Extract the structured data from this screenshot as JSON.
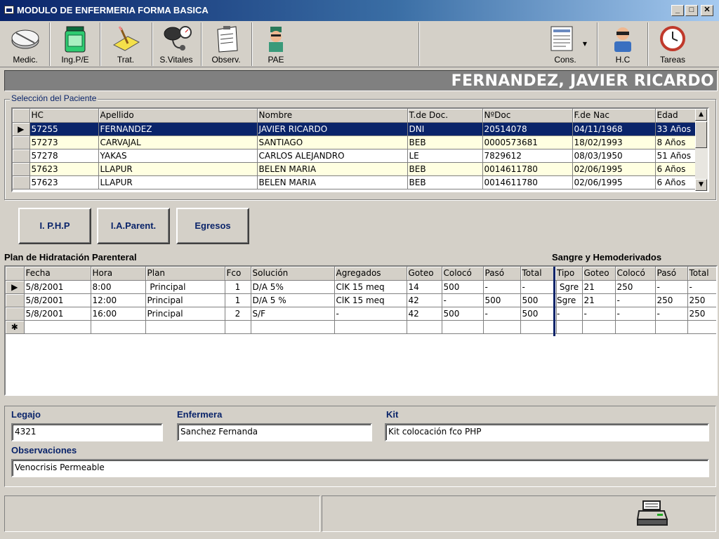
{
  "window": {
    "title": "MODULO DE ENFERMERIA FORMA BASICA"
  },
  "toolbar": {
    "left": [
      {
        "label": "Medic.",
        "icon": "pill-icon"
      },
      {
        "label": "Ing.P/E",
        "icon": "jar-icon"
      },
      {
        "label": "Trat.",
        "icon": "pencil-paper-icon"
      },
      {
        "label": "S.Vitales",
        "icon": "blood-pressure-icon"
      },
      {
        "label": "Observ.",
        "icon": "clipboard-icon"
      },
      {
        "label": "PAE",
        "icon": "nurse-icon"
      }
    ],
    "right": [
      {
        "label": "Cons.",
        "icon": "document-list-icon"
      },
      {
        "label": "H.C",
        "icon": "doctor-icon"
      },
      {
        "label": "Tareas",
        "icon": "clock-icon"
      }
    ]
  },
  "patient_name": "FERNANDEZ, JAVIER RICARDO",
  "patient_group_label": "Selección del Paciente",
  "patients": {
    "columns": [
      "HC",
      "Apellido",
      "Nombre",
      "T.de Doc.",
      "NºDoc",
      "F.de Nac",
      "Edad"
    ],
    "rows": [
      [
        "57255",
        "FERNANDEZ",
        "JAVIER RICARDO",
        "DNI",
        "20514078",
        "04/11/1968",
        "33 Años"
      ],
      [
        "57273",
        "CARVAJAL",
        "SANTIAGO",
        "BEB",
        "0000573681",
        "18/02/1993",
        "8 Años"
      ],
      [
        "57278",
        "YAKAS",
        "CARLOS ALEJANDRO",
        "LE",
        "7829612",
        "08/03/1950",
        "51 Años"
      ],
      [
        "57623",
        "LLAPUR",
        "BELEN MARIA",
        "BEB",
        "0014611780",
        "02/06/1995",
        "6 Años"
      ],
      [
        "57623",
        "LLAPUR",
        "BELEN MARIA",
        "BEB",
        "0014611780",
        "02/06/1995",
        "6 Años"
      ]
    ]
  },
  "buttons": {
    "iphp": "I. P.H.P",
    "iaparent": "I.A.Parent.",
    "egresos": "Egresos"
  },
  "plan": {
    "title": "Plan de Hidratación Parenteral",
    "columns": [
      "Fecha",
      "Hora",
      "Plan",
      "Fco",
      "Solución",
      "Agregados",
      "Goteo",
      "Colocó",
      "Pasó",
      "Total"
    ],
    "rows": [
      [
        "5/8/2001",
        "8:00",
        " Principal",
        "1",
        "D/A 5%",
        "ClK 15 meq",
        "14",
        "500",
        "-",
        "-"
      ],
      [
        "5/8/2001",
        "12:00",
        "Principal",
        "1",
        "D/A 5 %",
        "ClK 15 meq",
        "42",
        "-",
        "500",
        "500"
      ],
      [
        "5/8/2001",
        "16:00",
        "Principal",
        "2",
        "S/F",
        "-",
        "42",
        "500",
        "-",
        "500"
      ]
    ]
  },
  "sangre": {
    "title": "Sangre y Hemoderivados",
    "columns": [
      "Tipo",
      "Goteo",
      "Colocó",
      "Pasó",
      "Total"
    ],
    "rows": [
      [
        " Sgre",
        "21",
        "250",
        "-",
        "-"
      ],
      [
        "Sgre",
        "21",
        "-",
        "250",
        "250"
      ],
      [
        "-",
        "-",
        "-",
        "-",
        "250"
      ]
    ]
  },
  "form": {
    "legajo_label": "Legajo",
    "legajo": "4321",
    "enfermera_label": "Enfermera",
    "enfermera": "Sanchez Fernanda",
    "kit_label": "Kit",
    "kit": "Kit colocación fco PHP",
    "obs_label": "Observaciones",
    "obs": "Venocrisis Permeable"
  },
  "status": {
    "print_icon": "printer-icon"
  }
}
